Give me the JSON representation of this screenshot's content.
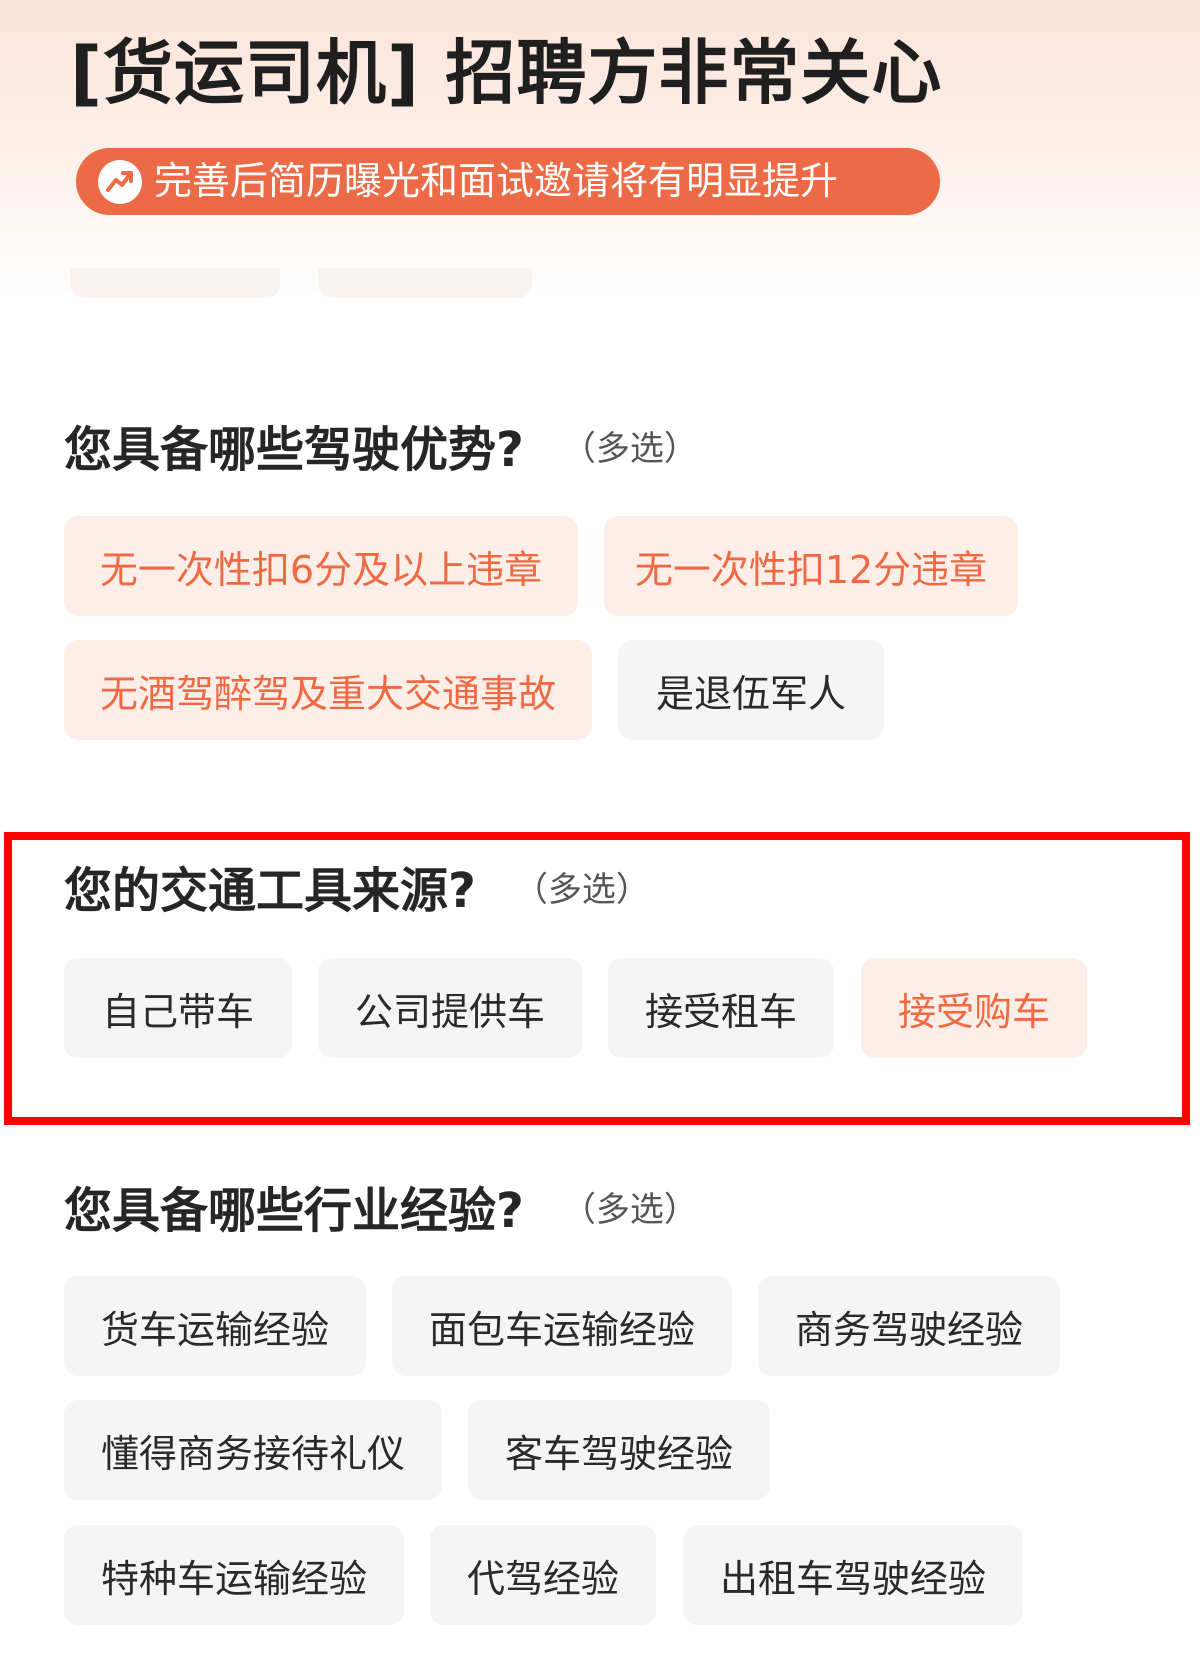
{
  "header": {
    "title": "[货运司机] 招聘方非常关心",
    "banner_text": "完善后简历曝光和面试邀请将有明显提升",
    "banner_icon": "trending-up-icon"
  },
  "colors": {
    "accent": "#ec6a45",
    "selected_bg": "#fdeee8",
    "selected_text": "#ef6a43",
    "chip_bg": "#f5f5f5",
    "highlight_border": "#ff0000"
  },
  "sections": [
    {
      "title": "您具备哪些驾驶优势?",
      "hint": "（多选）",
      "options": [
        {
          "label": "无一次性扣6分及以上违章",
          "selected": true
        },
        {
          "label": "无一次性扣12分违章",
          "selected": true
        },
        {
          "label": "无酒驾醉驾及重大交通事故",
          "selected": true
        },
        {
          "label": "是退伍军人",
          "selected": false
        }
      ]
    },
    {
      "title": "您的交通工具来源?",
      "hint": "（多选）",
      "options": [
        {
          "label": "自己带车",
          "selected": false
        },
        {
          "label": "公司提供车",
          "selected": false
        },
        {
          "label": "接受租车",
          "selected": false
        },
        {
          "label": "接受购车",
          "selected": true
        }
      ]
    },
    {
      "title": "您具备哪些行业经验?",
      "hint": "（多选）",
      "options": [
        {
          "label": "货车运输经验",
          "selected": false
        },
        {
          "label": "面包车运输经验",
          "selected": false
        },
        {
          "label": "商务驾驶经验",
          "selected": false
        },
        {
          "label": "懂得商务接待礼仪",
          "selected": false
        },
        {
          "label": "客车驾驶经验",
          "selected": false
        },
        {
          "label": "特种车运输经验",
          "selected": false
        },
        {
          "label": "代驾经验",
          "selected": false
        },
        {
          "label": "出租车驾驶经验",
          "selected": false
        }
      ]
    }
  ]
}
